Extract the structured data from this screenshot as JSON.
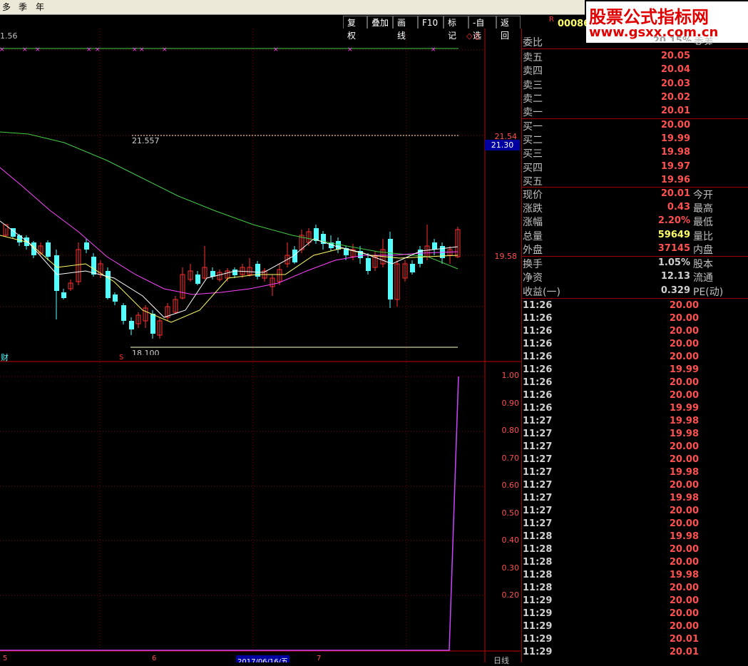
{
  "top_tabs": [
    "多",
    "季",
    "年"
  ],
  "toolbar": [
    "复权",
    "叠加",
    "画线",
    "F10",
    "标记",
    "-自选",
    "返回"
  ],
  "stock_code_prefix": "R",
  "stock_code": "00086",
  "watermark": {
    "line1": "股票公式指标网",
    "line2": "www.gsxx.com.cn"
  },
  "chart": {
    "top_left_value": "1.56",
    "annot_high": "21.557",
    "annot_low": "18.100",
    "axis_upper": [
      "21.54",
      "19.58"
    ],
    "axis_price_box": "21.30",
    "axis_lower": [
      "1.00",
      "0.90",
      "0.80",
      "0.70",
      "0.60",
      "0.50",
      "0.40",
      "0.30",
      "0.20"
    ],
    "bottom_left_label": "财",
    "x_labels": [
      "5",
      "6",
      "2017/06/16/五",
      "7"
    ],
    "corner_label": "日线"
  },
  "quote": {
    "weibi_label": "委比",
    "weibi_value": "20.15%",
    "weicha_label": "委差",
    "asks": [
      {
        "label": "卖五",
        "price": "20.05"
      },
      {
        "label": "卖四",
        "price": "20.04"
      },
      {
        "label": "卖三",
        "price": "20.03"
      },
      {
        "label": "卖二",
        "price": "20.02"
      },
      {
        "label": "卖一",
        "price": "20.01"
      }
    ],
    "bids": [
      {
        "label": "买一",
        "price": "20.00"
      },
      {
        "label": "买二",
        "price": "19.99"
      },
      {
        "label": "买三",
        "price": "19.98"
      },
      {
        "label": "买四",
        "price": "19.97"
      },
      {
        "label": "买五",
        "price": "19.96"
      }
    ],
    "stats": [
      {
        "label": "现价",
        "value": "20.01",
        "label2": "今开"
      },
      {
        "label": "涨跌",
        "value": "0.43",
        "label2": "最高"
      },
      {
        "label": "涨幅",
        "value": "2.20%",
        "label2": "最低"
      },
      {
        "label": "总量",
        "value": "59649",
        "label2": "量比"
      },
      {
        "label": "外盘",
        "value": "37145",
        "label2": "内盘"
      }
    ],
    "fund": [
      {
        "label": "换手",
        "value": "1.05%",
        "label2": "股本"
      },
      {
        "label": "净资",
        "value": "12.13",
        "label2": "流通"
      },
      {
        "label": "收益(一)",
        "value": "0.329",
        "label2": "PE(动)"
      }
    ]
  },
  "ticks": [
    {
      "time": "11:26",
      "price": "20.00"
    },
    {
      "time": "11:26",
      "price": "20.00"
    },
    {
      "time": "11:26",
      "price": "20.00"
    },
    {
      "time": "11:26",
      "price": "20.00"
    },
    {
      "time": "11:26",
      "price": "20.00"
    },
    {
      "time": "11:26",
      "price": "19.99"
    },
    {
      "time": "11:26",
      "price": "20.00"
    },
    {
      "time": "11:26",
      "price": "20.00"
    },
    {
      "time": "11:26",
      "price": "19.99"
    },
    {
      "time": "11:27",
      "price": "19.98"
    },
    {
      "time": "11:27",
      "price": "19.98"
    },
    {
      "time": "11:27",
      "price": "20.00"
    },
    {
      "time": "11:27",
      "price": "20.00"
    },
    {
      "time": "11:27",
      "price": "19.98"
    },
    {
      "time": "11:27",
      "price": "20.00"
    },
    {
      "time": "11:27",
      "price": "19.98"
    },
    {
      "time": "11:27",
      "price": "20.00"
    },
    {
      "time": "11:27",
      "price": "20.00"
    },
    {
      "time": "11:28",
      "price": "19.98"
    },
    {
      "time": "11:28",
      "price": "20.00"
    },
    {
      "time": "11:28",
      "price": "20.00"
    },
    {
      "time": "11:28",
      "price": "19.98"
    },
    {
      "time": "11:28",
      "price": "20.00"
    },
    {
      "time": "11:29",
      "price": "20.00"
    },
    {
      "time": "11:29",
      "price": "20.00"
    },
    {
      "time": "11:29",
      "price": "20.00"
    },
    {
      "time": "11:29",
      "price": "20.01"
    },
    {
      "time": "11:29",
      "price": "20.01"
    }
  ],
  "colors": {
    "up": "#ff3030",
    "down": "#54ffff",
    "ma_white": "#ffffff",
    "ma_yellow": "#ffff66",
    "ma_purple": "#ff44ff",
    "ma_green": "#44cc44",
    "grid": "#800000"
  }
}
